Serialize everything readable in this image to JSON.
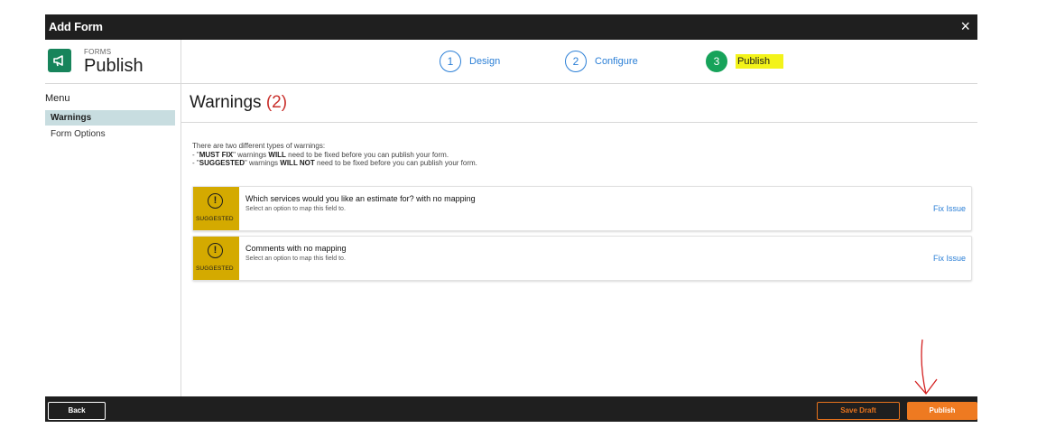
{
  "window": {
    "title": "Add Form",
    "close_icon": "×"
  },
  "brand": {
    "kicker": "FORMS",
    "name": "Publish",
    "icon": "megaphone-icon",
    "color": "#17845b"
  },
  "steps": [
    {
      "number": "1",
      "label": "Design",
      "state": "complete"
    },
    {
      "number": "2",
      "label": "Configure",
      "state": "complete"
    },
    {
      "number": "3",
      "label": "Publish",
      "state": "active"
    }
  ],
  "sidebar": {
    "title": "Menu",
    "items": [
      {
        "label": "Warnings",
        "active": true
      },
      {
        "label": "Form Options",
        "active": false
      }
    ]
  },
  "main": {
    "heading": "Warnings",
    "count": "(2)",
    "intro": {
      "line1": "There are two different types of warnings:",
      "line2_pre": "- \"",
      "line2_strong1": "MUST FIX",
      "line2_mid": "\" warnings ",
      "line2_strong2": "WILL",
      "line2_post": " need to be fixed before you can publish your form.",
      "line3_pre": "- \"",
      "line3_strong1": "SUGGESTED",
      "line3_mid": "\" warnings ",
      "line3_strong2": "WILL NOT",
      "line3_post": " need to be fixed before you can publish your form."
    },
    "warnings": [
      {
        "severity": "SUGGESTED",
        "title": "Which services would you like an estimate for? with no mapping",
        "description": "Select an option to map this field to.",
        "action": "Fix Issue"
      },
      {
        "severity": "SUGGESTED",
        "title": "Comments with no mapping",
        "description": "Select an option to map this field to.",
        "action": "Fix Issue"
      }
    ]
  },
  "footer": {
    "back_label": "Back",
    "save_draft_label": "Save Draft",
    "publish_label": "Publish"
  },
  "colors": {
    "accent_blue": "#2b7fd6",
    "success_green": "#17a35a",
    "warning_yellow": "#d4aa00",
    "orange": "#ee7a21",
    "error_red": "#c9302c",
    "highlight_yellow": "#f3f31a"
  },
  "icons": {
    "warning_icon": "exclamation-circle-icon"
  }
}
